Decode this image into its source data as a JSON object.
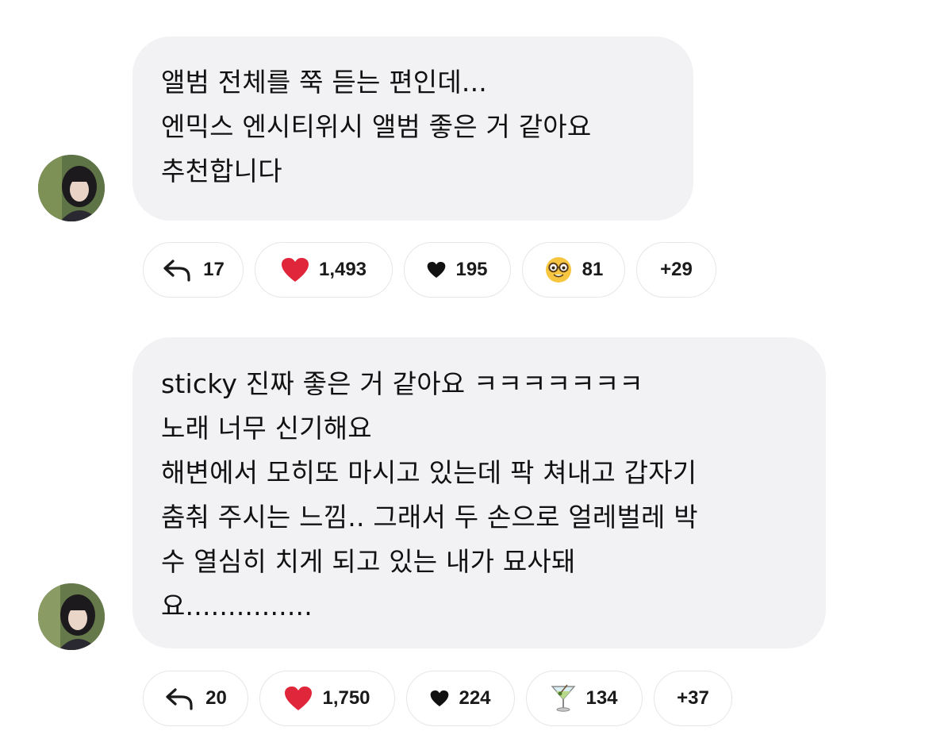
{
  "comments": [
    {
      "lines": [
        "앨범 전체를 쭉 듣는 편인데...",
        "엔믹스 엔시티위시 앨범 좋은 거 같아요",
        "추천합니다"
      ],
      "reply_count": "17",
      "reactions": [
        {
          "icon": "red-heart-icon",
          "count": "1,493"
        },
        {
          "icon": "black-heart-icon",
          "count": "195"
        },
        {
          "icon": "nerd-face-icon",
          "count": "81"
        }
      ],
      "more": "+29"
    },
    {
      "lines": [
        "sticky 진짜 좋은 거 같아요 ㅋㅋㅋㅋㅋㅋㅋ",
        "노래 너무 신기해요",
        "해변에서 모히또 마시고 있는데 팍 쳐내고 갑자기",
        "춤춰 주시는 느낌.. 그래서 두 손으로 얼레벌레 박",
        "수 열심히 치게 되고 있는 내가 묘사돼",
        "요..............."
      ],
      "reply_count": "20",
      "reactions": [
        {
          "icon": "red-heart-icon",
          "count": "1,750"
        },
        {
          "icon": "black-heart-icon",
          "count": "224"
        },
        {
          "icon": "cocktail-glass-icon",
          "count": "134"
        }
      ],
      "more": "+37"
    }
  ],
  "colors": {
    "bubble_bg": "#f2f2f4",
    "pill_border": "#e6e6e9",
    "red_heart": "#e0263a"
  }
}
